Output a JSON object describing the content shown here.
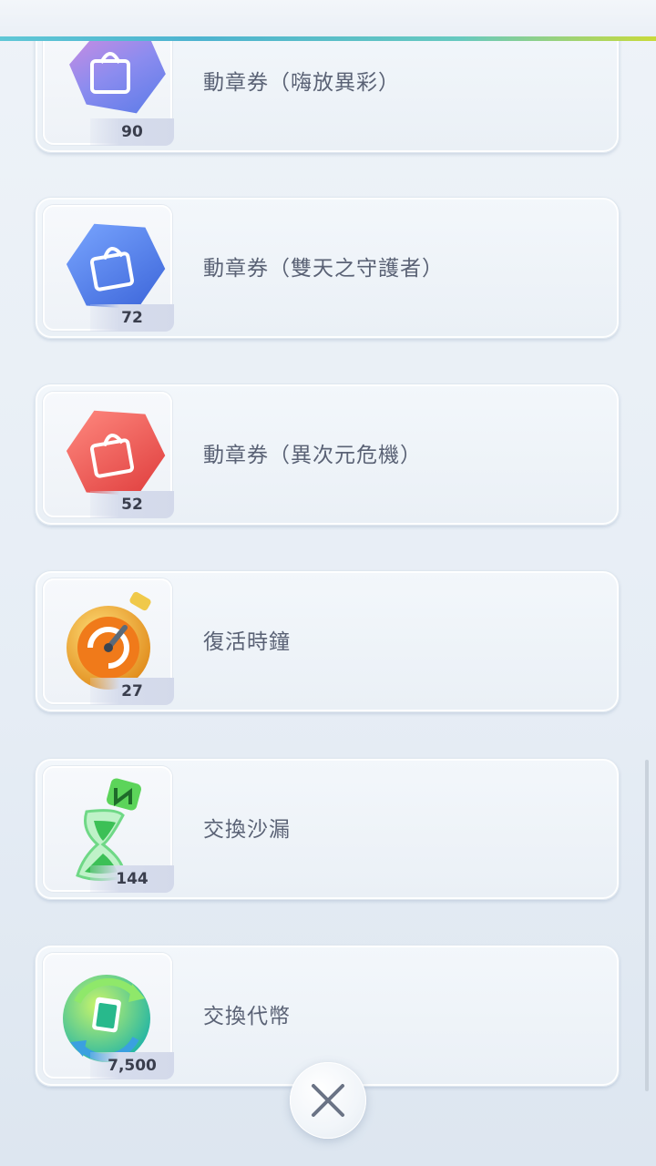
{
  "items": [
    {
      "name": "動章券（嗨放異彩）",
      "quantity": "90",
      "icon": "ticket-bag-purple-icon",
      "color": "#8f86e6"
    },
    {
      "name": "動章券（雙天之守護者）",
      "quantity": "72",
      "icon": "ticket-bag-blue-icon",
      "color": "#4f7fe6"
    },
    {
      "name": "動章券（異次元危機）",
      "quantity": "52",
      "icon": "ticket-bag-red-icon",
      "color": "#ee5a55"
    },
    {
      "name": "復活時鐘",
      "quantity": "27",
      "icon": "revive-clock-icon",
      "color": "#f0a22e"
    },
    {
      "name": "交換沙漏",
      "quantity": "144",
      "icon": "exchange-hourglass-icon",
      "color": "#55d06a"
    },
    {
      "name": "交換代幣",
      "quantity": "7,500",
      "icon": "exchange-token-icon",
      "color": "#3ec46a"
    }
  ],
  "close_button": {
    "icon": "close-icon"
  }
}
